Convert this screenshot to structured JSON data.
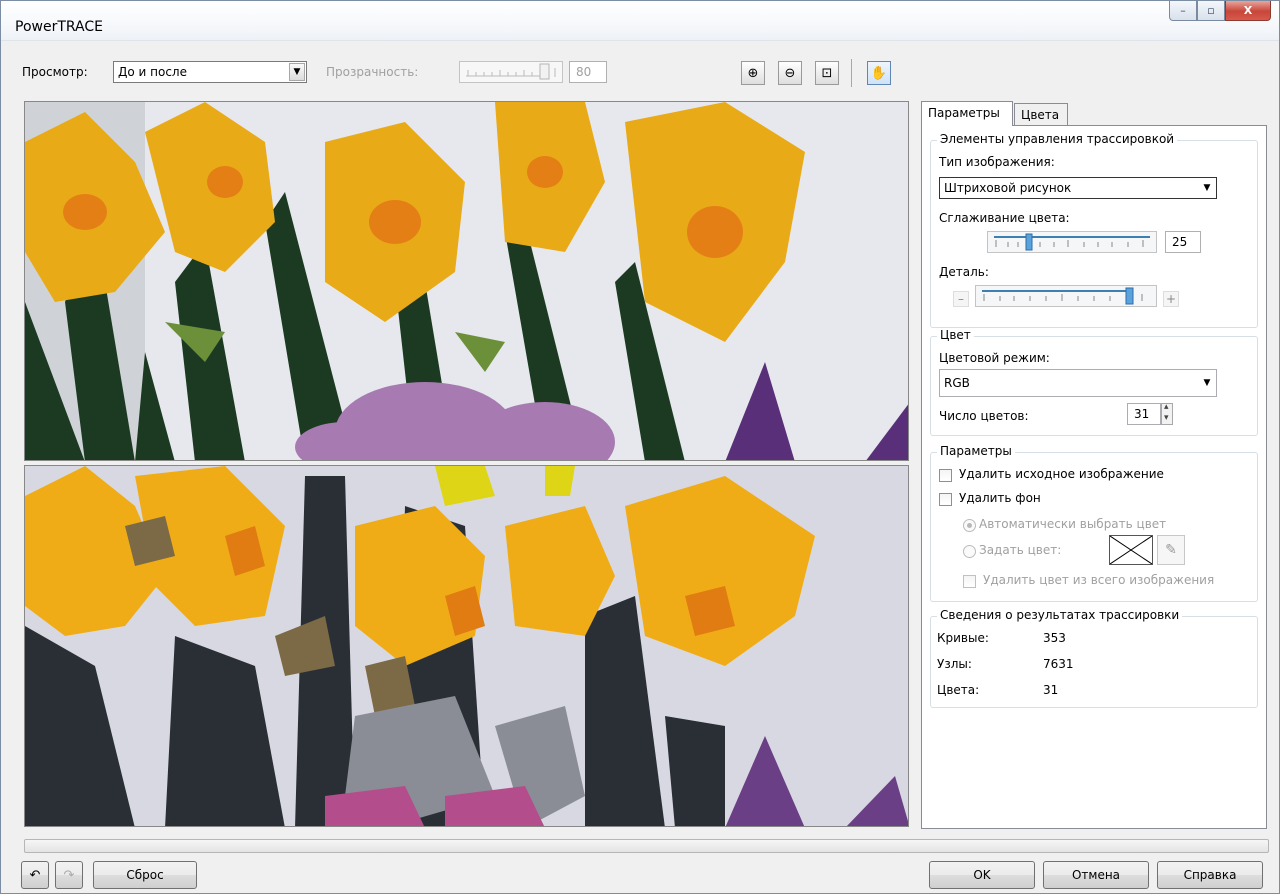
{
  "window": {
    "title": "PowerTRACE",
    "minimize_glyph": "–",
    "maximize_glyph": "▫",
    "close_glyph": "X"
  },
  "toolbar": {
    "view_label": "Просмотр:",
    "view_value": "До и после",
    "transparency_label": "Прозрачность:",
    "transparency_value": "80",
    "zoom_in_icon": "zoom-in-icon",
    "zoom_out_icon": "zoom-out-icon",
    "fit_icon": "zoom-fit-icon",
    "pan_icon": "hand-icon",
    "zoom_in_glyph": "⊕",
    "zoom_out_glyph": "⊖",
    "fit_glyph": "⊡",
    "pan_glyph": "✋"
  },
  "tabs": [
    {
      "label": "Параметры",
      "active": true
    },
    {
      "label": "Цвета",
      "active": false
    }
  ],
  "trace_controls": {
    "title": "Элементы управления трассировкой",
    "image_type_label": "Тип изображения:",
    "image_type_value": "Штриховой рисунок",
    "smoothing_label": "Сглаживание цвета:",
    "smoothing_value": "25",
    "detail_label": "Деталь:",
    "detail_minus": "–",
    "detail_plus": "+",
    "detail_level": 0.95
  },
  "color": {
    "title": "Цвет",
    "mode_label": "Цветовой режим:",
    "mode_value": "RGB",
    "count_label": "Число цветов:",
    "count_value": "31"
  },
  "params": {
    "title": "Параметры",
    "delete_original": "Удалить исходное изображение",
    "delete_background": "Удалить фон",
    "auto_color": "Автоматически выбрать цвет",
    "set_color": "Задать цвет:",
    "delete_color_all": "Удалить цвет из всего изображения"
  },
  "results": {
    "title": "Сведения о результатах трассировки",
    "rows": [
      {
        "label": "Кривые:",
        "value": "353"
      },
      {
        "label": "Узлы:",
        "value": "7631"
      },
      {
        "label": "Цвета:",
        "value": "31"
      }
    ]
  },
  "bottom": {
    "reset": "Сброс",
    "ok": "OK",
    "cancel": "Отмена",
    "help": "Справка",
    "undo_icon": "undo-icon",
    "redo_icon": "redo-icon",
    "undo_glyph": "↶",
    "redo_glyph": "↷"
  },
  "colors": {
    "accent": "#3c7fb1",
    "daffodil": "#e8a813",
    "stem": "#1f3a1f",
    "crocus": "#7a3f92"
  }
}
